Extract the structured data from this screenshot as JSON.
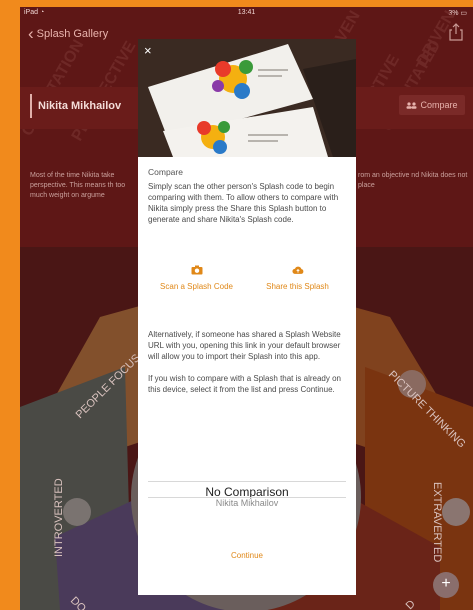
{
  "status_bar": {
    "left": "iPad ◔",
    "time": "13:41",
    "battery": "3% ▭"
  },
  "nav": {
    "back_label": "Splash Gallery"
  },
  "profile": {
    "name": "Nikita Mikhailov",
    "compare_label": "Compare",
    "description_left": "Most of the time Nikita take perspective. This means th too much weight on argume",
    "description_right": "rom an objective nd Nikita does not place"
  },
  "diagram_labels": {
    "people_focused": "PEOPLE FOCUS",
    "big_picture": "PICTURE THINKING",
    "introverted": "INTROVERTED",
    "extraverted": "EXTRAVERTED",
    "bottom_left": "DO",
    "bottom_right": "D"
  },
  "watermark": {
    "words": [
      "ORIENTATION",
      "PERSPECTIVE",
      "DRIVEN",
      "ORIENTATED",
      "SPECTIVE",
      "DRIVEN"
    ]
  },
  "modal": {
    "close_glyph": "×",
    "title": "Compare",
    "intro": "Simply scan the other person's Splash code to begin comparing with them. To allow others to compare with Nikita simply press the Share this Splash button to generate and share Nikita's Splash code.",
    "scan_label": "Scan a Splash Code",
    "share_label": "Share this Splash",
    "alt_paragraph_1": "Alternatively, if someone has shared a Splash Website URL with you, opening this link in your default browser will allow you to import their Splash into this app.",
    "alt_paragraph_2": "If you wish to compare with a Splash that is already on this device, select it from the list and press Continue.",
    "picker_selected": "No Comparison",
    "picker_next": "Nikita Mikhailov",
    "continue_label": "Continue"
  },
  "fab_label": "+",
  "colors": {
    "accent": "#e08818",
    "backdrop": "#5e1716",
    "border_orange": "#f18a1c"
  }
}
